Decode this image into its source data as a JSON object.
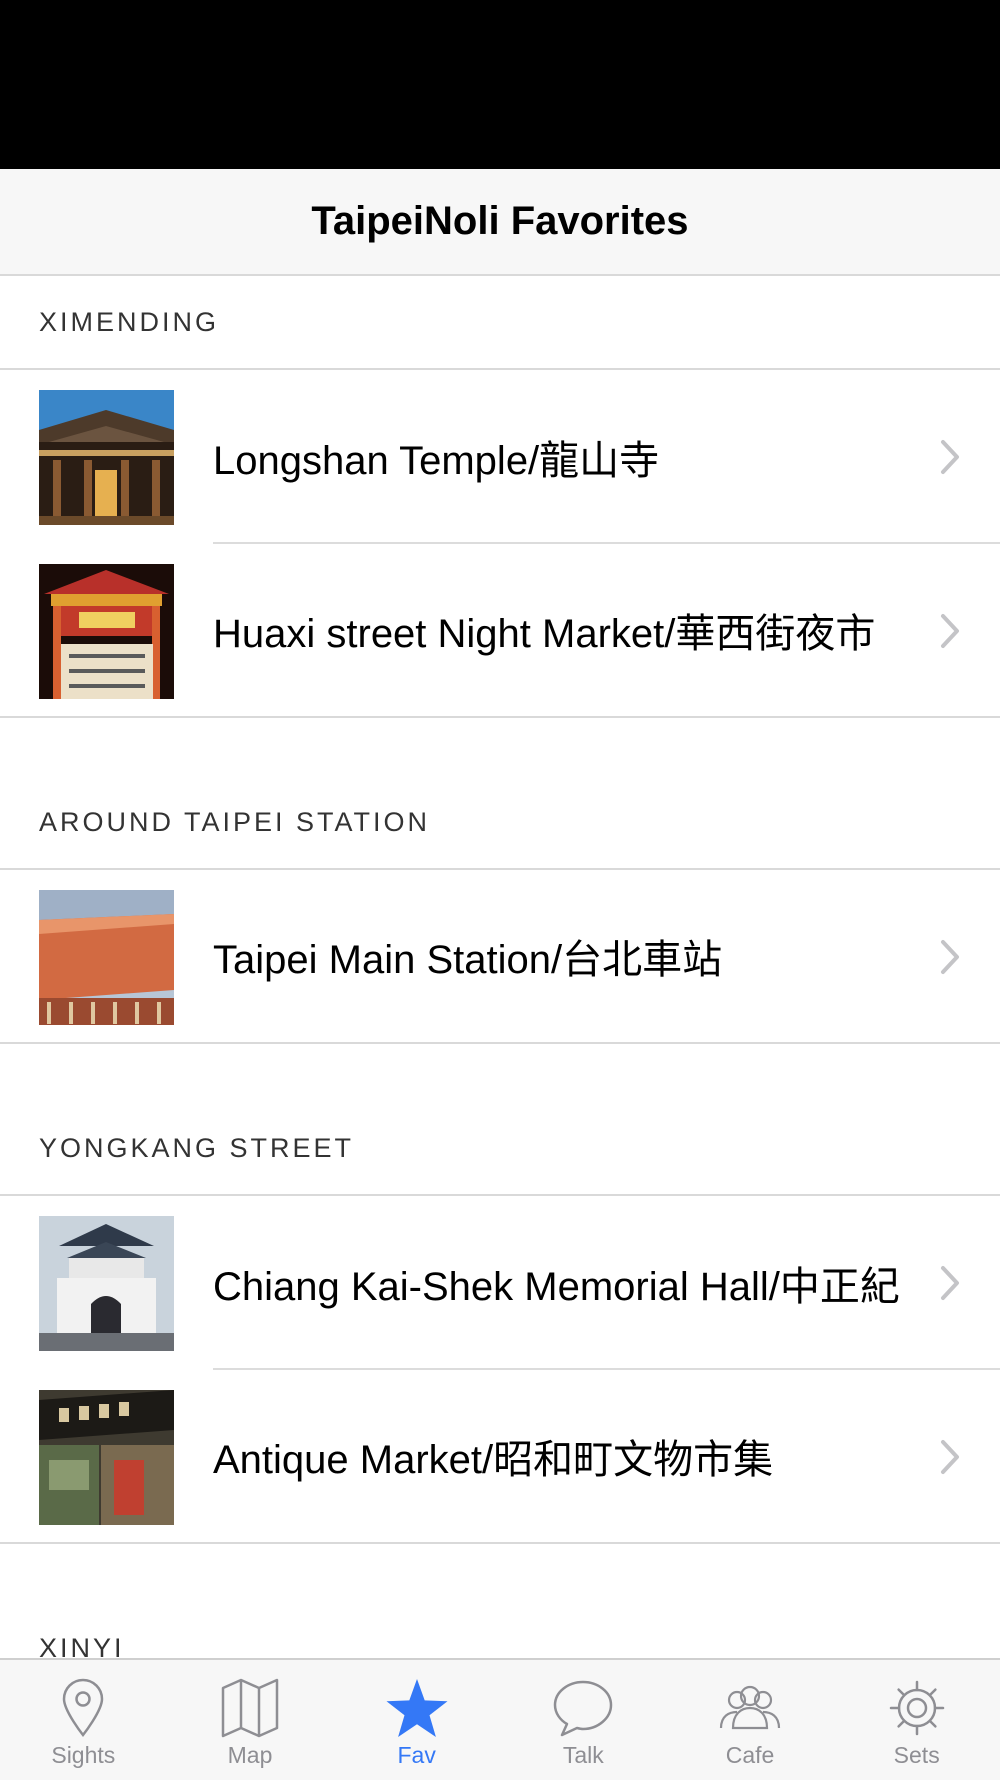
{
  "nav": {
    "title": "TaipeiNoli Favorites"
  },
  "sections": [
    {
      "header": "XIMENDING",
      "items": [
        {
          "label": "Longshan Temple/龍山寺"
        },
        {
          "label": "Huaxi street Night Market/華西街夜市"
        }
      ]
    },
    {
      "header": "AROUND TAIPEI STATION",
      "items": [
        {
          "label": "Taipei Main Station/台北車站"
        }
      ]
    },
    {
      "header": "YONGKANG STREET",
      "items": [
        {
          "label": "Chiang Kai-Shek Memorial Hall/中正紀"
        },
        {
          "label": "Antique Market/昭和町文物市集"
        }
      ]
    },
    {
      "header": "XINYI",
      "items": []
    }
  ],
  "tabs": [
    {
      "label": "Sights",
      "icon": "location-pin-icon"
    },
    {
      "label": "Map",
      "icon": "map-icon"
    },
    {
      "label": "Fav",
      "icon": "star-icon",
      "active": true
    },
    {
      "label": "Talk",
      "icon": "speech-bubble-icon"
    },
    {
      "label": "Cafe",
      "icon": "people-icon"
    },
    {
      "label": "Sets",
      "icon": "gear-icon"
    }
  ],
  "colors": {
    "accent": "#3478f6",
    "inactive": "#8e8e93",
    "bar_bg": "#f7f7f7"
  }
}
